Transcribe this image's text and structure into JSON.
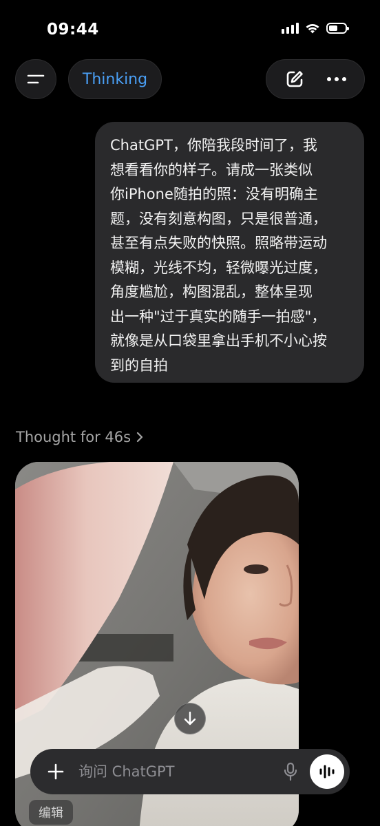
{
  "status_bar": {
    "time": "09:44",
    "icons": [
      "signal-icon",
      "wifi-icon",
      "battery-icon"
    ],
    "battery_level": 0.55
  },
  "header": {
    "menu_icon": "menu-icon",
    "mode_label": "Thinking",
    "new_chat_icon": "edit-icon",
    "more_icon": "more-icon"
  },
  "conversation": {
    "user_message_lines": [
      "ChatGPT，你陪我段时间了，我",
      "想看看你的样子。请成一张类似",
      "你iPhone随拍的照：没有明确主",
      "题，没有刻意构图，只是很普通，",
      "甚至有点失败的快照。照略带运动",
      "模糊，光线不均，轻微曝光过度，",
      "角度尴尬，构图混乱，整体呈现",
      "出一种\"过于真实的随手一拍感\"，",
      "就像是从口袋里拿出手机不小心按",
      "到的自拍"
    ],
    "thought_label": "Thought for 46s"
  },
  "composer": {
    "placeholder": "询问 ChatGPT",
    "edit_chip": "编辑"
  },
  "colors": {
    "background": "#000000",
    "bubble": "#2a2a2c",
    "accent": "#4a9ff5",
    "muted_text": "#a6a6a6"
  }
}
